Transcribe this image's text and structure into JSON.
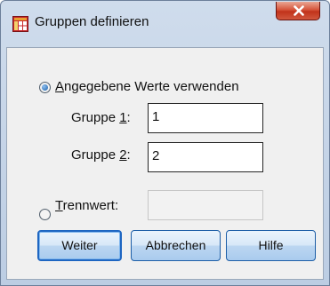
{
  "window": {
    "title": "Gruppen definieren",
    "icon": "grid-icon",
    "close_icon": "close-icon"
  },
  "options": {
    "specified_values": {
      "prefix": "",
      "mnemonic": "A",
      "rest": "ngegebene Werte verwenden",
      "checked": true
    },
    "group1": {
      "prefix": "Gruppe ",
      "mnemonic": "1",
      "suffix": ":",
      "value": "1"
    },
    "group2": {
      "prefix": "Gruppe ",
      "mnemonic": "2",
      "suffix": ":",
      "value": "2"
    },
    "cut_point": {
      "mnemonic": "T",
      "rest": "rennwert:",
      "checked": false,
      "value": ""
    }
  },
  "buttons": {
    "continue": "Weiter",
    "cancel": "Abbrechen",
    "help": "Hilfe"
  },
  "colors": {
    "accent": "#1e66c2",
    "close": "#c1331b"
  }
}
